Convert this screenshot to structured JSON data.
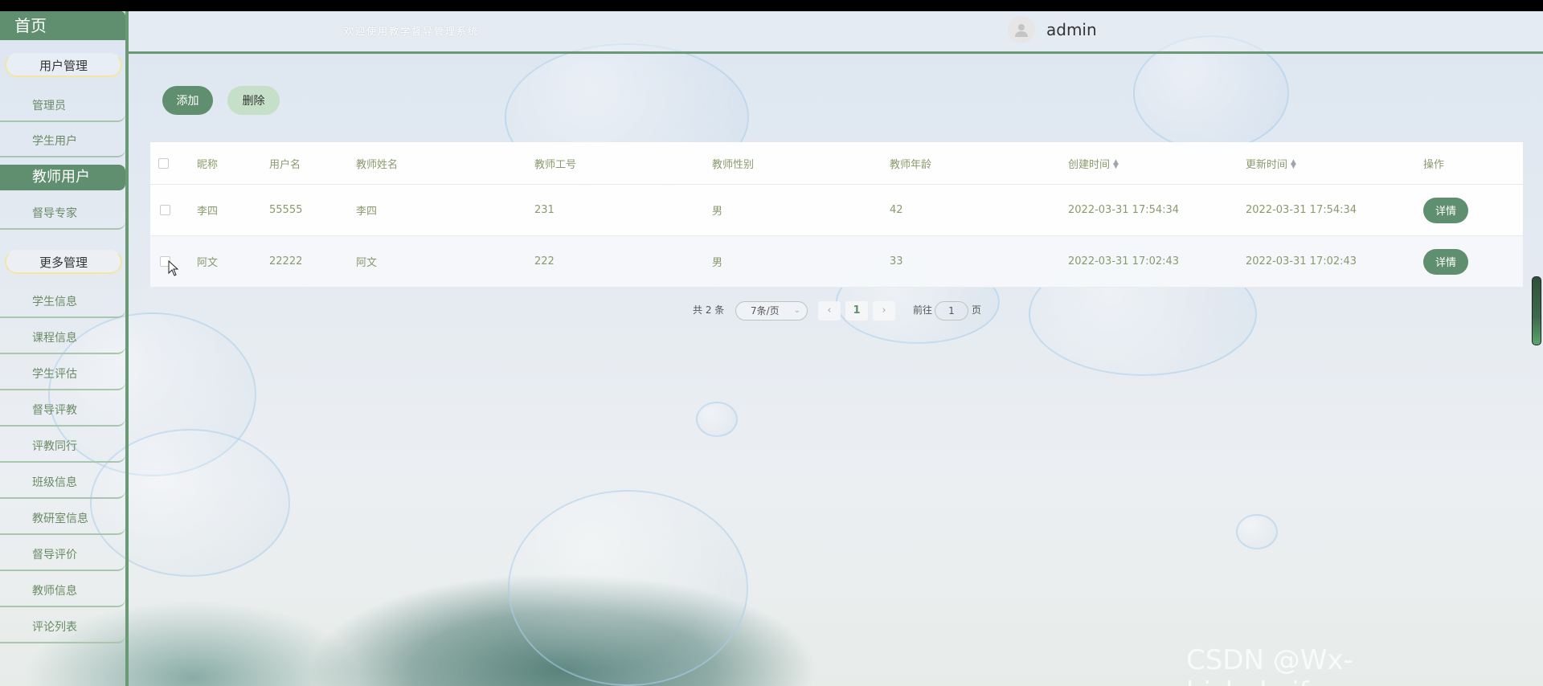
{
  "header": {
    "title": "欢迎使用教学督导管理系统",
    "username": "admin"
  },
  "sidebar": {
    "home": "首页",
    "groups": {
      "user_mgmt": "用户管理",
      "teacher_users": "教师用户",
      "more_mgmt": "更多管理"
    },
    "items": {
      "admin": "管理员",
      "student_user": "学生用户",
      "supervisor_expert": "督导专家",
      "student_info": "学生信息",
      "course_info": "课程信息",
      "student_eval": "学生评估",
      "supervisor_eval_teaching": "督导评教",
      "peer_eval": "评教同行",
      "class_info": "班级信息",
      "research_room": "教研室信息",
      "supervisor_review": "督导评价",
      "teacher_info": "教师信息",
      "comment_list": "评论列表"
    }
  },
  "toolbar": {
    "add_label": "添加",
    "delete_label": "删除"
  },
  "table": {
    "headers": {
      "nickname": "昵称",
      "username": "用户名",
      "teacher_name": "教师姓名",
      "teacher_id": "教师工号",
      "gender": "教师性别",
      "age": "教师年龄",
      "created": "创建时间",
      "updated": "更新时间",
      "actions": "操作"
    },
    "rows": [
      {
        "nickname": "李四",
        "username": "55555",
        "teacher_name": "李四",
        "teacher_id": "231",
        "gender": "男",
        "age": "42",
        "created": "2022-03-31 17:54:34",
        "updated": "2022-03-31 17:54:34",
        "detail": "详情"
      },
      {
        "nickname": "阿文",
        "username": "22222",
        "teacher_name": "阿文",
        "teacher_id": "222",
        "gender": "男",
        "age": "33",
        "created": "2022-03-31 17:02:43",
        "updated": "2022-03-31 17:02:43",
        "detail": "详情"
      }
    ]
  },
  "pagination": {
    "total_text": "共 2 条",
    "page_size": "7条/页",
    "current_page": "1",
    "goto_prefix": "前往",
    "goto_value": "1",
    "goto_suffix": "页"
  },
  "watermark": "CSDN @Wx-bishekaifayuan",
  "colors": {
    "accent": "#5f8f6e",
    "accent_light": "#c6dfc8",
    "table_text": "#8a9a6c"
  }
}
